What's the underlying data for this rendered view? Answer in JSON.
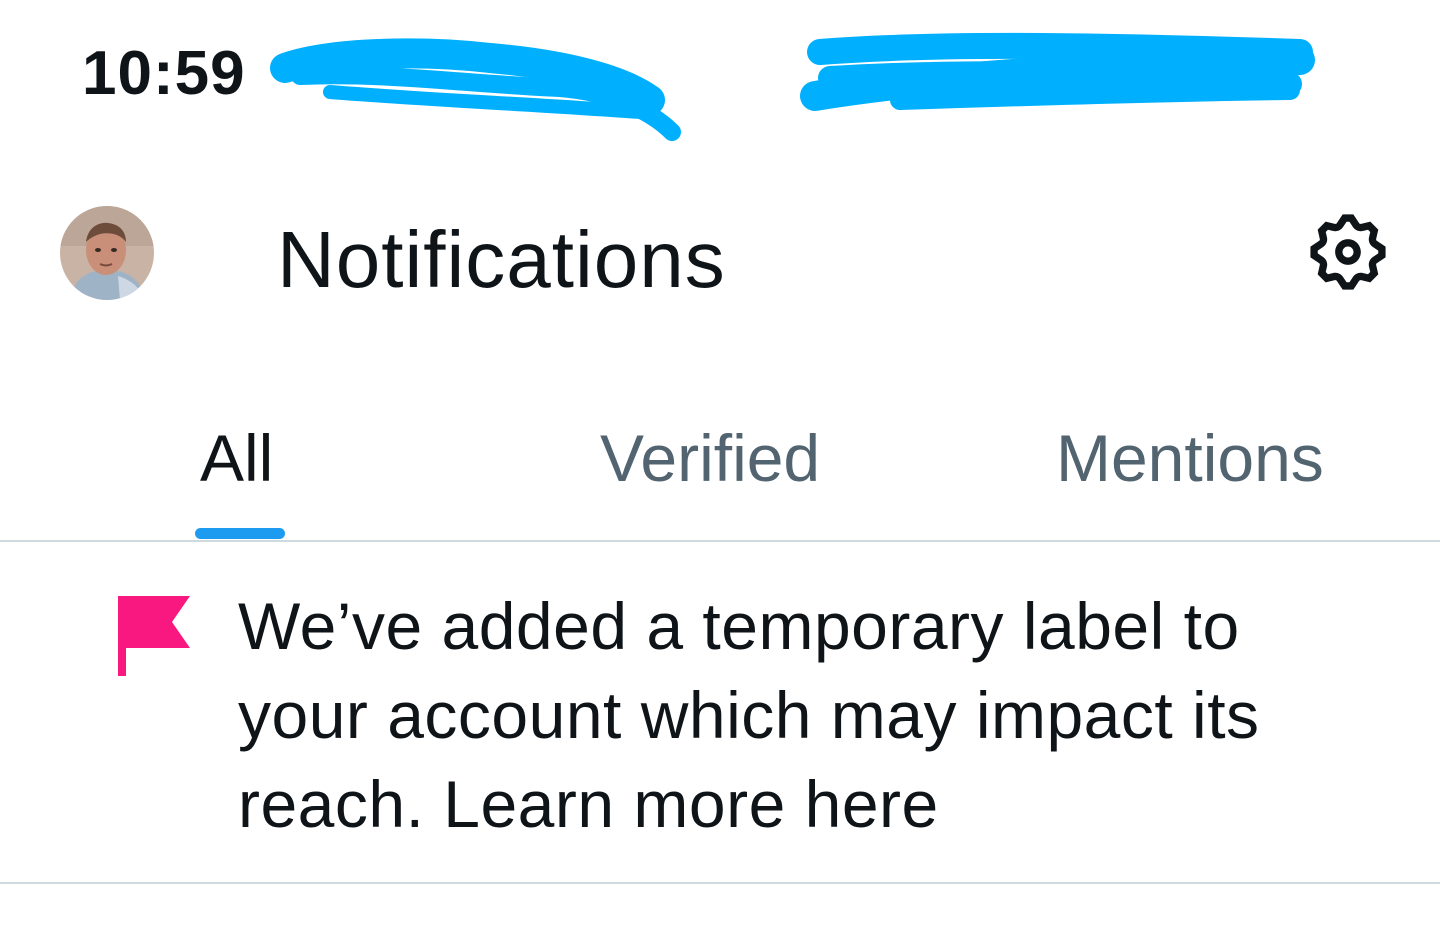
{
  "status_bar": {
    "time": "10:59"
  },
  "header": {
    "title": "Notifications",
    "avatar_icon": "user-avatar",
    "settings_icon": "gear-icon"
  },
  "tabs": [
    {
      "label": "All",
      "active": true
    },
    {
      "label": "Verified",
      "active": false
    },
    {
      "label": "Mentions",
      "active": false
    }
  ],
  "notification": {
    "icon": "flag-icon",
    "text": "We’ve added a temporary label to your account which may impact its reach. Learn more here"
  },
  "colors": {
    "accent": "#1d9bf0",
    "flag": "#f91880",
    "redaction": "#00b0ff",
    "divider": "#cfd9de",
    "inactive_tab": "#536471",
    "text": "#0f1419"
  }
}
